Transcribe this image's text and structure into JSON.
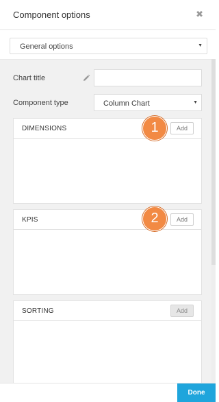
{
  "header": {
    "title": "Component options",
    "close_icon": "close-icon"
  },
  "section_select": {
    "value": "General options"
  },
  "form": {
    "chart_title_label": "Chart title",
    "chart_title_value": "",
    "component_type_label": "Component type",
    "component_type_value": "Column Chart"
  },
  "cards": {
    "dimensions": {
      "title": "DIMENSIONS",
      "add_label": "Add",
      "badge": "1"
    },
    "kpis": {
      "title": "KPIS",
      "add_label": "Add",
      "badge": "2"
    },
    "sorting": {
      "title": "SORTING",
      "add_label": "Add"
    }
  },
  "footer": {
    "done_label": "Done"
  },
  "colors": {
    "accent": "#1fa5dc",
    "badge": "#f28a44",
    "panel_bg": "#f1f1f1"
  }
}
